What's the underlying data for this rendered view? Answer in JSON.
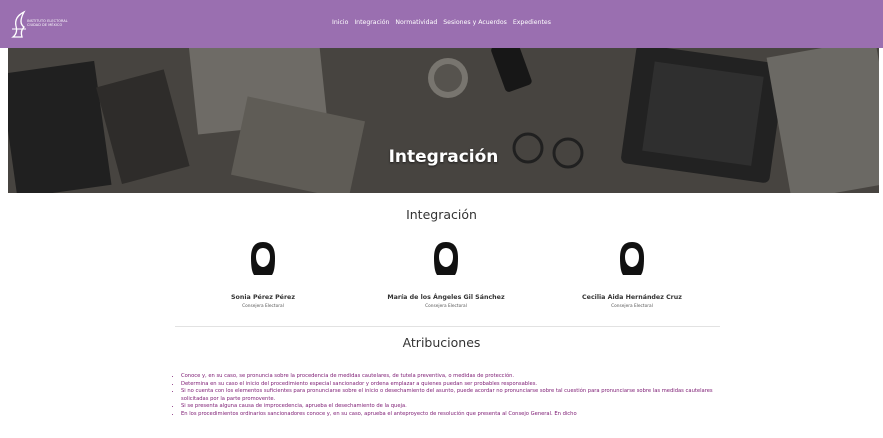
{
  "nav": {
    "logo_text": "INSTITUTO ELECTORAL CIUDAD DE MÉXICO",
    "links": [
      "Inicio",
      "Integración",
      "Normatividad",
      "Sesiones y Acuerdos",
      "Expedientes"
    ]
  },
  "hero": {
    "title": "Integración"
  },
  "integration": {
    "title": "Integración",
    "members": [
      {
        "name": "Sonia Pérez Pérez",
        "role": "Consejera Electoral"
      },
      {
        "name": "María de los Ángeles Gil Sánchez",
        "role": "Consejera Electoral"
      },
      {
        "name": "Cecilia Aida Hernández Cruz",
        "role": "Consejera Electoral"
      }
    ]
  },
  "attributions": {
    "title": "Atribuciones",
    "items": [
      "Conoce y, en su caso, se pronuncia sobre la procedencia de medidas cautelares, de tutela preventiva, o medidas de protección.",
      "Determina en su caso el inicio del procedimiento especial sancionador y ordena emplazar a quienes puedan ser probables responsables.",
      "Si no cuenta con los elementos suficientes para pronunciarse sobre el inicio o desechamiento del asunto, puede acordar no pronunciarse sobre tal cuestión para pronunciarse sobre las medidas cautelares solicitadas por la parte promovente.",
      "Si se presenta alguna causa de improcedencia, aprueba el desechamiento de la queja.",
      "En los procedimientos ordinarios sancionadores conoce y, en su caso, aprueba el anteproyecto de resolución que presenta al Consejo General. En dicho"
    ]
  },
  "colors": {
    "navbar": "#9a6fb0",
    "attribution_text": "#7a1670"
  }
}
